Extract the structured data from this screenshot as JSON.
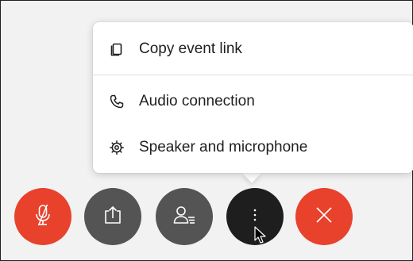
{
  "menu": {
    "items": [
      {
        "label": "Copy event link",
        "icon": "copy-icon"
      },
      {
        "label": "Audio connection",
        "icon": "phone-icon"
      },
      {
        "label": "Speaker and microphone",
        "icon": "gear-icon"
      }
    ]
  },
  "controls": [
    {
      "name": "mute-microphone",
      "icon": "microphone-off-icon",
      "color": "#e8412c"
    },
    {
      "name": "share-content",
      "icon": "share-icon",
      "color": "#545454"
    },
    {
      "name": "participants",
      "icon": "participants-icon",
      "color": "#545454"
    },
    {
      "name": "more-options",
      "icon": "more-vertical-icon",
      "color": "#1e1e1e"
    },
    {
      "name": "leave-meeting",
      "icon": "close-icon",
      "color": "#e8412c"
    }
  ]
}
